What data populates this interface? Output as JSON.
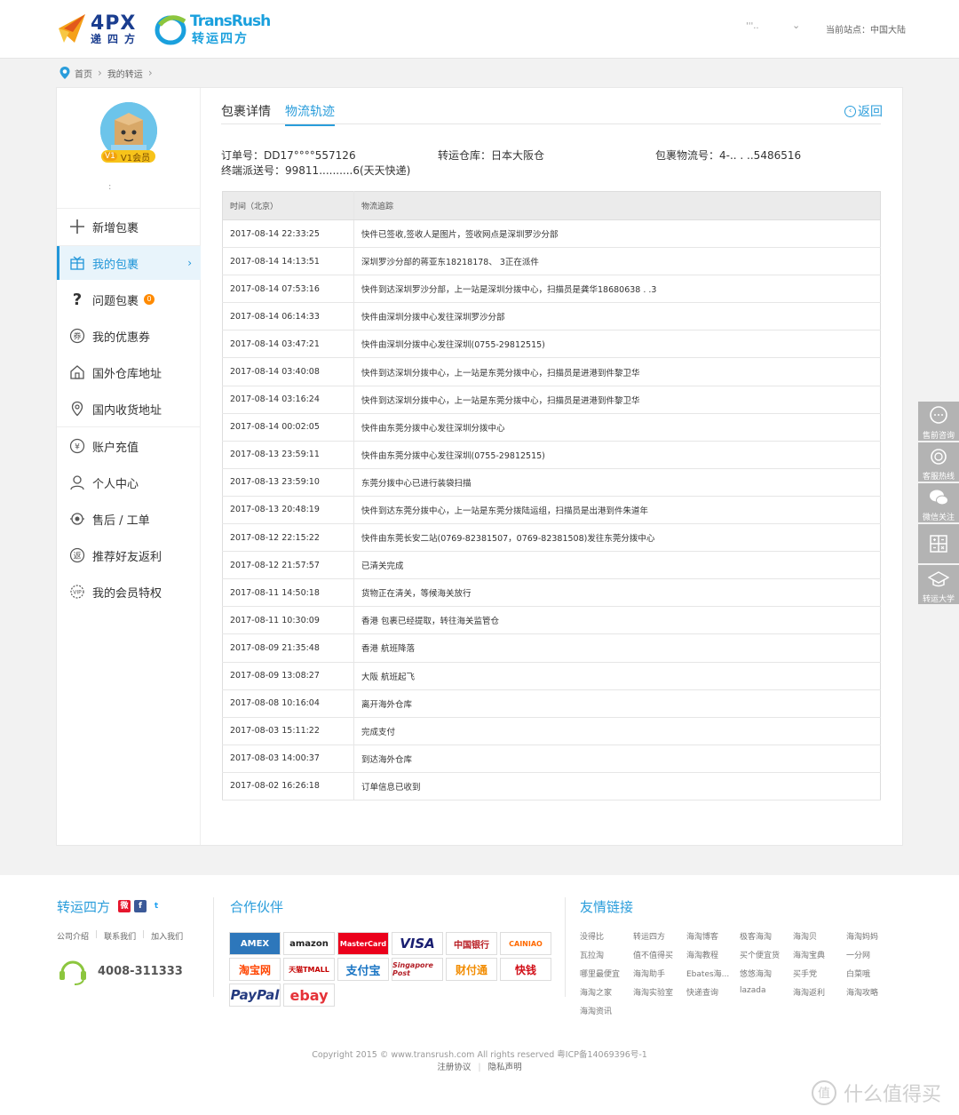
{
  "header": {
    "logo_4px_text": "4PX",
    "logo_4px_sub": "递四方",
    "logo_tr_text": "TransRush",
    "logo_tr_sub": "转运四方",
    "user_name": "'''..",
    "site_label": "当前站点：中国大陆"
  },
  "breadcrumb": {
    "home": "首页",
    "current": "我的转运"
  },
  "sidebar": {
    "vip_level": "V1",
    "vip_label": "V1会员",
    "username_masked": ":",
    "items": [
      {
        "label": "新增包裹",
        "icon": "plus-icon"
      },
      {
        "label": "我的包裹",
        "icon": "package-icon",
        "active": true
      },
      {
        "label": "问题包裹",
        "icon": "question-icon",
        "badge": "0"
      },
      {
        "label": "我的优惠券",
        "icon": "coupon-icon"
      },
      {
        "label": "国外仓库地址",
        "icon": "warehouse-icon"
      },
      {
        "label": "国内收货地址",
        "icon": "location-icon"
      },
      {
        "label": "账户充值",
        "icon": "yen-icon"
      },
      {
        "label": "个人中心",
        "icon": "user-icon"
      },
      {
        "label": "售后 / 工单",
        "icon": "service-icon"
      },
      {
        "label": "推荐好友返利",
        "icon": "refund-icon"
      },
      {
        "label": "我的会员特权",
        "icon": "vip-icon"
      }
    ]
  },
  "tabs": [
    {
      "label": "包裹详情",
      "active": false
    },
    {
      "label": "物流轨迹",
      "active": true
    }
  ],
  "back_label": "返回",
  "info": {
    "order_label": "订单号：",
    "order_value": "DD17°°°°557126",
    "warehouse_label": "转运仓库：",
    "warehouse_value": "日本大阪仓",
    "tracking_label": "包裹物流号：",
    "tracking_value": "4-.. . ..5486516",
    "final_label": "终端派送号：",
    "final_value": "99811..........6(天天快递)"
  },
  "table": {
    "headers": [
      "时间（北京）",
      "物流追踪"
    ],
    "rows": [
      [
        "2017-08-14 22:33:25",
        "快件已签收,签收人是图片，签收网点是深圳罗沙分部"
      ],
      [
        "2017-08-14 14:13:51",
        "深圳罗沙分部的蒋亚东18218178、 3正在派件"
      ],
      [
        "2017-08-14 07:53:16",
        "快件到达深圳罗沙分部，上一站是深圳分拨中心，扫描员是龚华18680638 . .3"
      ],
      [
        "2017-08-14 06:14:33",
        "快件由深圳分拨中心发往深圳罗沙分部"
      ],
      [
        "2017-08-14 03:47:21",
        "快件由深圳分拨中心发往深圳(0755-29812515)"
      ],
      [
        "2017-08-14 03:40:08",
        "快件到达深圳分拨中心，上一站是东莞分拨中心，扫描员是进港到件黎卫华"
      ],
      [
        "2017-08-14 03:16:24",
        "快件到达深圳分拨中心，上一站是东莞分拨中心，扫描员是进港到件黎卫华"
      ],
      [
        "2017-08-14 00:02:05",
        "快件由东莞分拨中心发往深圳分拨中心"
      ],
      [
        "2017-08-13 23:59:11",
        "快件由东莞分拨中心发往深圳(0755-29812515)"
      ],
      [
        "2017-08-13 23:59:10",
        "东莞分拨中心已进行装袋扫描"
      ],
      [
        "2017-08-13 20:48:19",
        "快件到达东莞分拨中心，上一站是东莞分拨陆运组，扫描员是出港到件朱道年"
      ],
      [
        "2017-08-12 22:15:22",
        "快件由东莞长安二站(0769-82381507，0769-82381508)发往东莞分拨中心"
      ],
      [
        "2017-08-12 21:57:57",
        "已清关完成"
      ],
      [
        "2017-08-11 14:50:18",
        "货物正在清关，等候海关放行"
      ],
      [
        "2017-08-11 10:30:09",
        "香港 包裹已经提取，转往海关监管仓"
      ],
      [
        "2017-08-09 21:35:48",
        "香港 航班降落"
      ],
      [
        "2017-08-09 13:08:27",
        "大阪 航班起飞"
      ],
      [
        "2017-08-08 10:16:04",
        "离开海外仓库"
      ],
      [
        "2017-08-03 15:11:22",
        "完成支付"
      ],
      [
        "2017-08-03 14:00:37",
        "到达海外仓库"
      ],
      [
        "2017-08-02 16:26:18",
        "订单信息已收到"
      ]
    ]
  },
  "float_bar": [
    "售前咨询",
    "客服热线",
    "微信关注",
    "",
    "转运大学"
  ],
  "footer": {
    "brand_title": "转运四方",
    "links": [
      "公司介绍",
      "联系我们",
      "加入我们"
    ],
    "phone": "4008-311333",
    "partners_title": "合作伙伴",
    "partners": [
      "AMEX",
      "amazon",
      "MasterCard",
      "VISA",
      "中国银行",
      "CAINIAO",
      "淘宝网",
      "天猫TMALL",
      "支付宝",
      "Singapore Post",
      "财付通",
      "快钱",
      "PayPal",
      "ebay"
    ],
    "friends_title": "友情链接",
    "friends": [
      "没得比",
      "转运四方",
      "海淘博客",
      "极客海淘",
      "海淘贝",
      "海淘妈妈",
      "瓦拉淘",
      "值不值得买",
      "海淘教程",
      "买个便宜货",
      "海淘宝典",
      "一分网",
      "哪里最便宜",
      "海淘助手",
      "Ebates海...",
      "悠悠海淘",
      "买手党",
      "白菜哦",
      "海淘之家",
      "海淘实验室",
      "快递查询",
      "lazada",
      "海淘返利",
      "海淘攻略",
      "海淘资讯"
    ],
    "copyright": "Copyright 2015 © www.transrush.com All rights reserved 粤ICP备14069396号-1",
    "bottom_links": [
      "注册协议",
      "隐私声明"
    ]
  },
  "watermark": "什么值得买",
  "colors": {
    "accent": "#2a9ddb",
    "active_bg": "#e8f4fb",
    "float_bg": "#b3b3b3"
  }
}
